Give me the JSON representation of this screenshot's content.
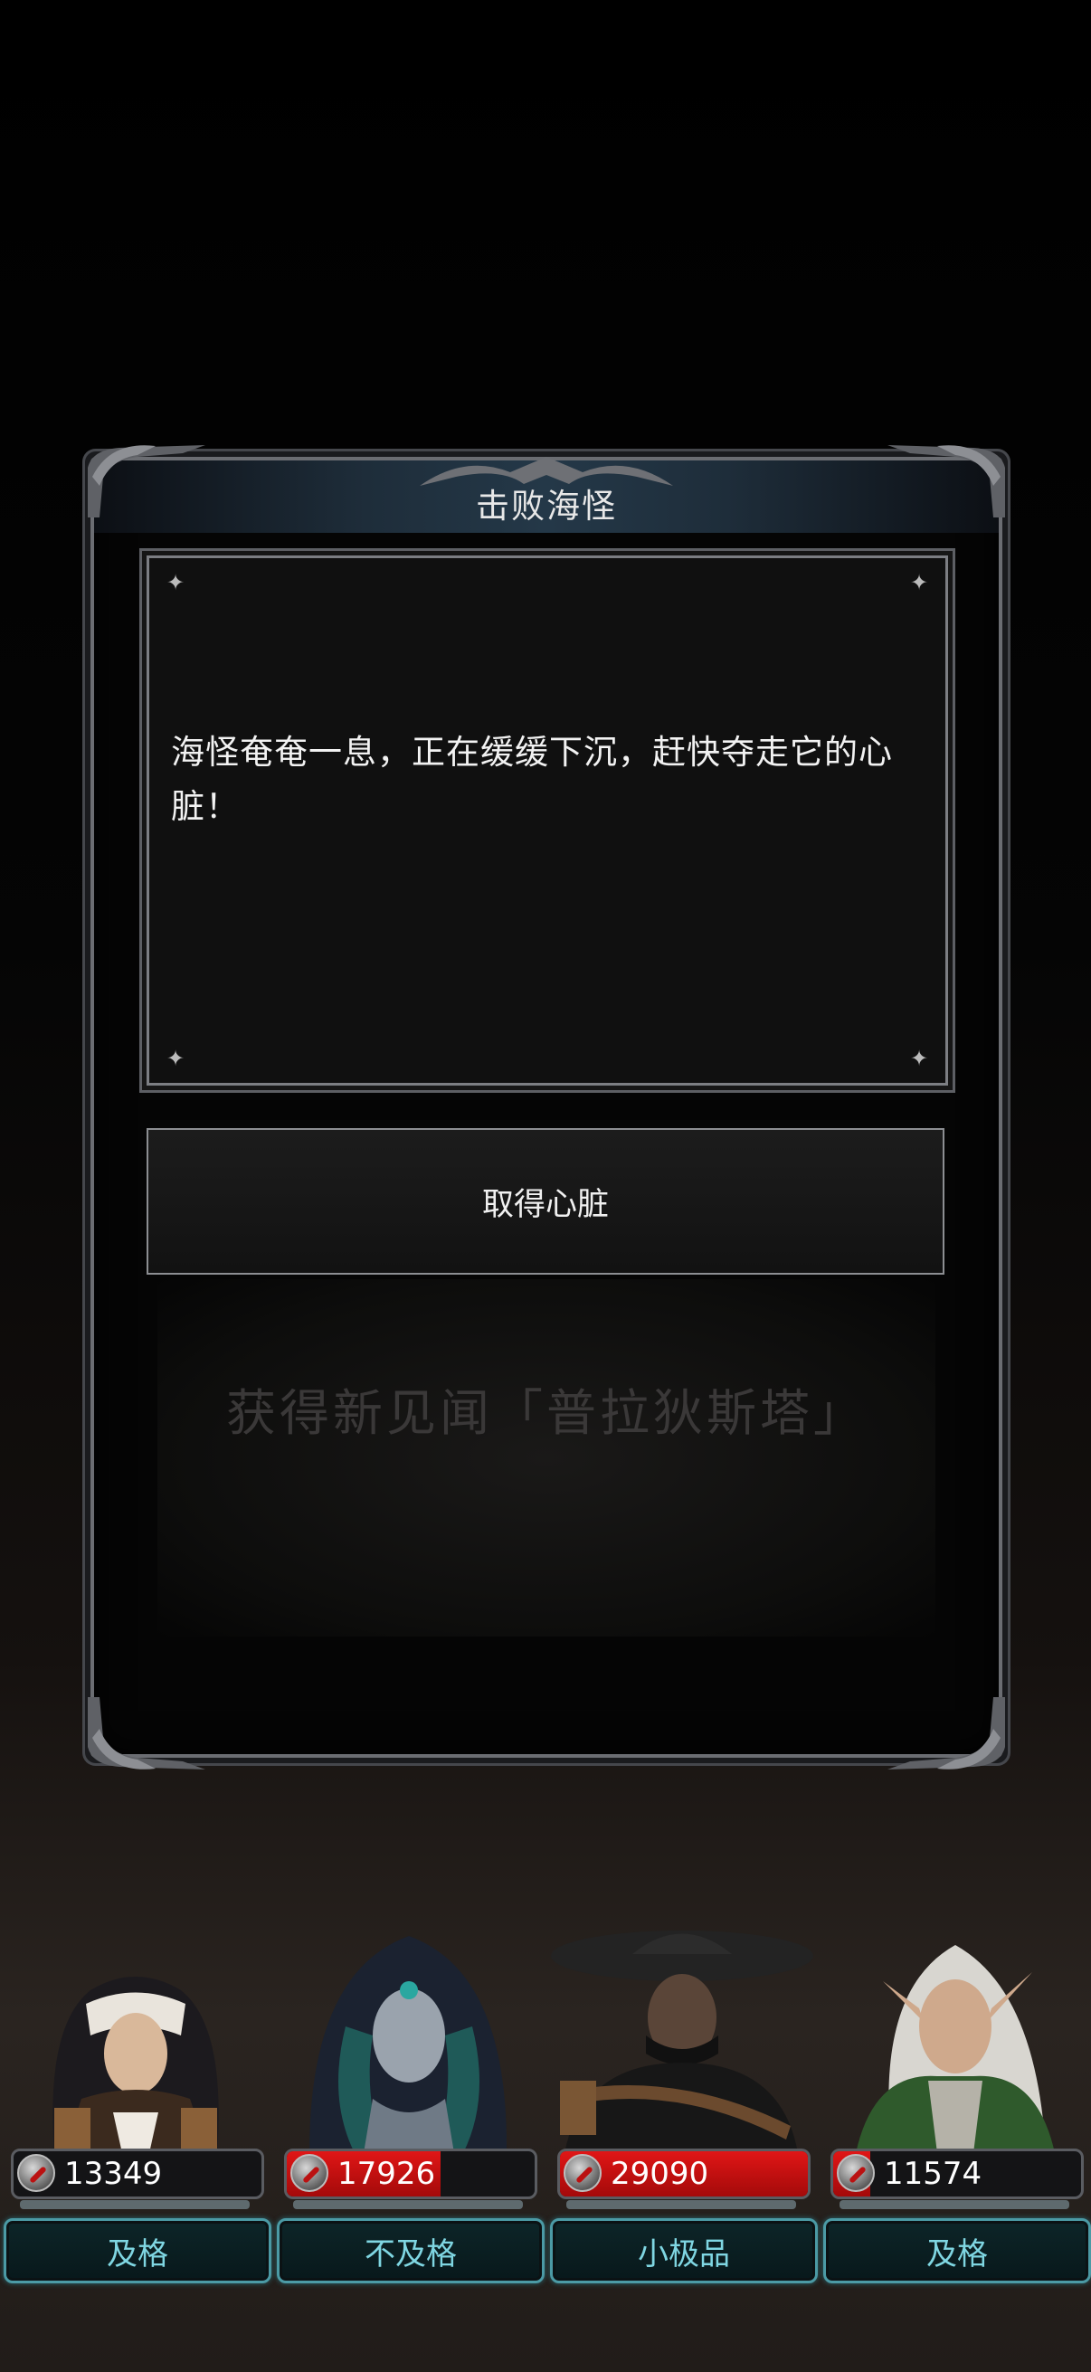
{
  "dialog": {
    "title": "击败海怪",
    "story_text": "海怪奄奄一息，正在缓缓下沉，赶快夺走它的心脏！",
    "action_label": "取得心脏",
    "notice": "获得新见闻「普拉狄斯塔」"
  },
  "party": [
    {
      "name": "nun",
      "value": "13349",
      "grade": "及格",
      "fill_fraction": 0.0
    },
    {
      "name": "hooded-sorceress",
      "value": "17926",
      "grade": "不及格",
      "fill_fraction": 0.62
    },
    {
      "name": "hatted-warrior",
      "value": "29090",
      "grade": "小极品",
      "fill_fraction": 1.0
    },
    {
      "name": "elf",
      "value": "11574",
      "grade": "及格",
      "fill_fraction": 0.15
    }
  ],
  "colors": {
    "accent_cyan": "#7fd6e2",
    "power_red": "#e01616",
    "frame_steel": "#6b6d72"
  }
}
